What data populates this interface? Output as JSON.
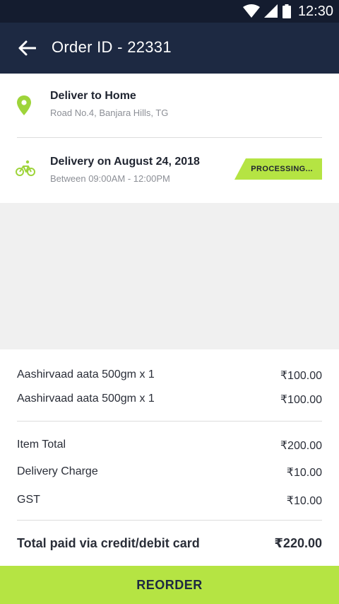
{
  "status_bar": {
    "time": "12:30"
  },
  "header": {
    "title": "Order ID - 22331"
  },
  "delivery": {
    "deliver_title": "Deliver to Home",
    "address": "Road No.4, Banjara Hills, TG",
    "date_title": "Delivery on August 24, 2018",
    "window": "Between 09:00AM - 12:00PM",
    "status": "PROCESSING..."
  },
  "items": [
    {
      "name": "Aashirvaad aata 500gm x 1",
      "price": "₹100.00"
    },
    {
      "name": "Aashirvaad aata 500gm x 1",
      "price": "₹100.00"
    }
  ],
  "summary": {
    "item_total_label": "Item Total",
    "item_total": "₹200.00",
    "delivery_label": "Delivery Charge",
    "delivery": "₹10.00",
    "gst_label": "GST",
    "gst": "₹10.00",
    "total_label": "Total paid via credit/debit card",
    "total": "₹220.00"
  },
  "actions": {
    "reorder": "REORDER"
  },
  "colors": {
    "accent": "#b5e443",
    "header": "#1d2942",
    "status_bar": "#141c2f"
  },
  "icons": [
    "wifi-icon",
    "signal-icon",
    "battery-icon",
    "back-arrow-icon",
    "location-pin-icon",
    "bicycle-icon"
  ]
}
